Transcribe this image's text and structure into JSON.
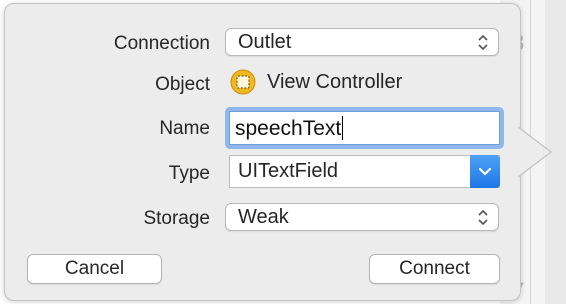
{
  "background": {
    "line_numbers": [
      "3",
      "7"
    ]
  },
  "dialog": {
    "connection": {
      "label": "Connection",
      "value": "Outlet",
      "icon": "stepper-icon"
    },
    "object": {
      "label": "Object",
      "value": "View Controller",
      "icon": "view-controller-icon"
    },
    "name": {
      "label": "Name",
      "value": "speechText"
    },
    "type": {
      "label": "Type",
      "value": "UITextField",
      "icon": "chevron-down-icon"
    },
    "storage": {
      "label": "Storage",
      "value": "Weak",
      "icon": "stepper-icon"
    },
    "buttons": {
      "cancel": "Cancel",
      "connect": "Connect"
    }
  },
  "colors": {
    "focus_ring": "#90b8ec",
    "accent": "#1d76e6",
    "object_icon": "#f2b91e"
  }
}
